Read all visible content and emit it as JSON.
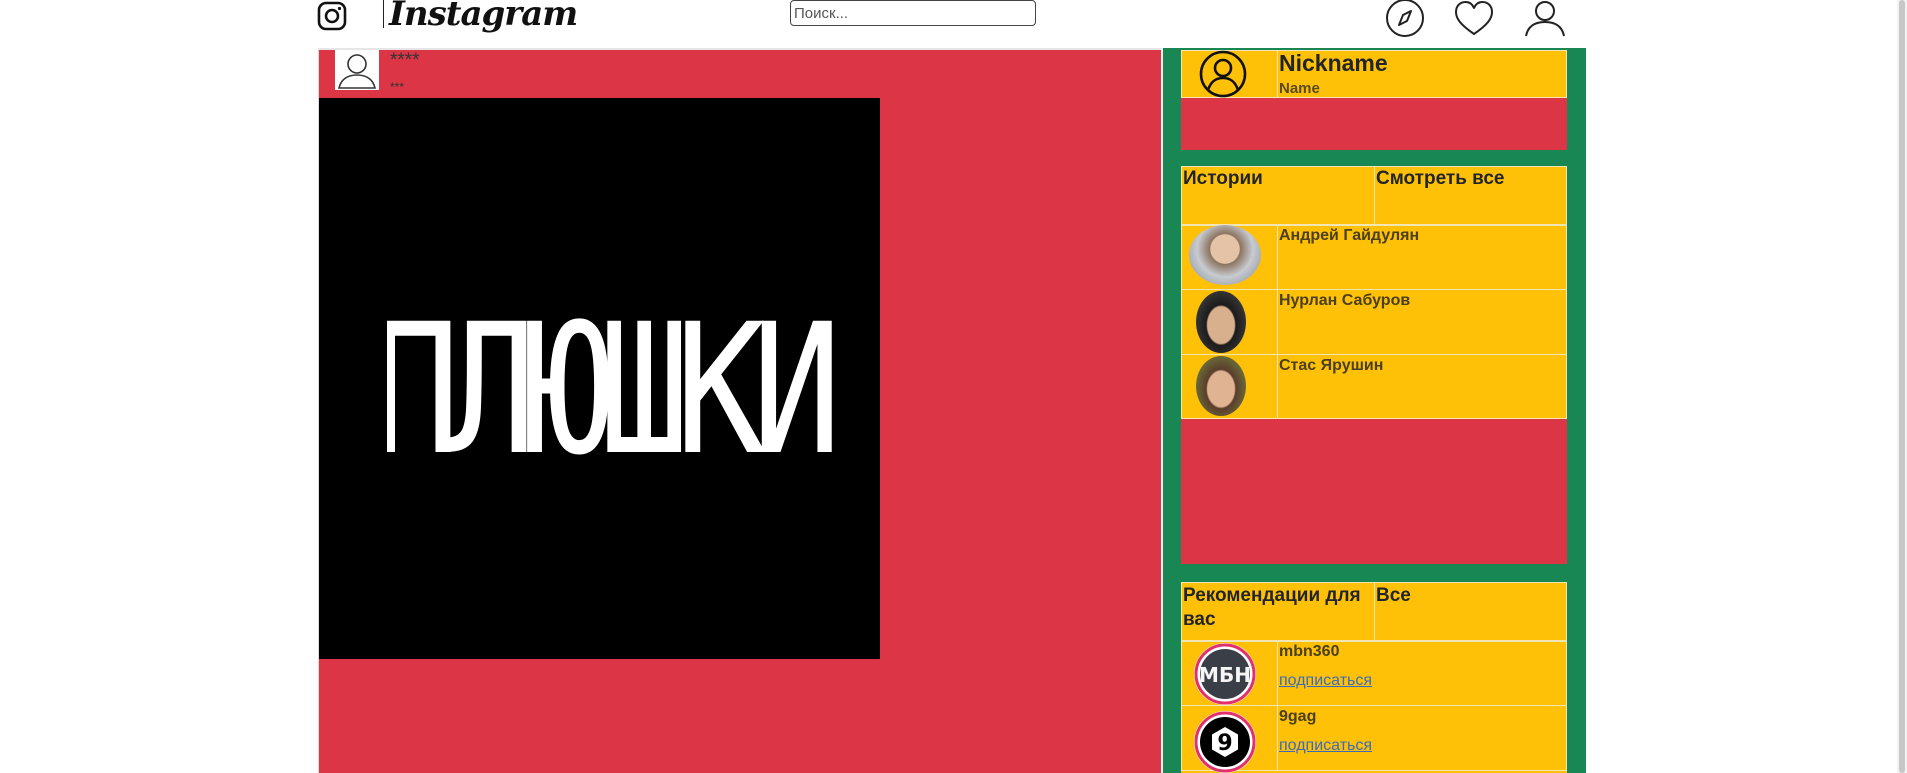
{
  "header": {
    "brand": "Instagram",
    "search_placeholder": "Поиск..."
  },
  "post": {
    "username": "****",
    "subtitle": "***",
    "image_text": "ПЛЮШКИ"
  },
  "profile": {
    "nickname": "Nickname",
    "name": "Name"
  },
  "stories": {
    "title": "Истории",
    "see_all": "Смотреть все",
    "items": [
      {
        "name": "Андрей Гайдулян"
      },
      {
        "name": "Нурлан Сабуров"
      },
      {
        "name": "Стас Ярушин"
      }
    ]
  },
  "recommendations": {
    "title": "Рекомендации для вас",
    "all": "Все",
    "items": [
      {
        "name": "mbn360",
        "action": "подписаться",
        "avatar_text": "МБН"
      },
      {
        "name": "9gag",
        "action": "подписаться",
        "avatar_text": "9"
      }
    ]
  },
  "colors": {
    "feed_bg": "#dc3545",
    "sidebar_bg": "#198754",
    "card_bg": "#ffc107"
  }
}
